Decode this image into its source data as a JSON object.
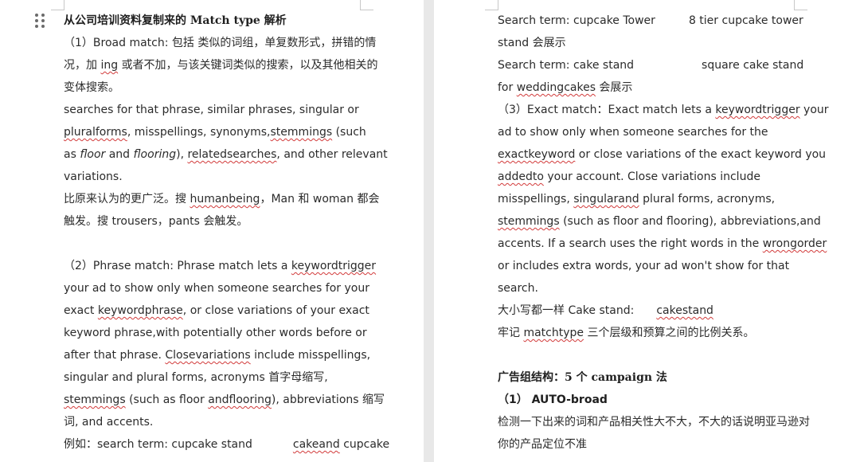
{
  "left": {
    "title": "从公司培训资料复制来的 Match type 解析",
    "broad_intro_1": "（1）Broad match: 包括 类似的词组，单复数形式，拼错的情",
    "broad_intro_2a": "况，加",
    "broad_intro_2b": "ing",
    "broad_intro_2c": "或者不加，与该关键词类似的搜索，以及其他相关的",
    "broad_intro_3": "变体搜索。",
    "broad_en_1": "searches for that phrase, similar phrases, singular or",
    "broad_en_2a": "pluralforms",
    "broad_en_2b": ", misspellings, synonyms,",
    "broad_en_2c": "stemmings",
    "broad_en_2d": " (such",
    "broad_en_3a": "as ",
    "broad_en_3b": "floor",
    "broad_en_3c": " and ",
    "broad_en_3d": "flooring",
    "broad_en_3e": "), ",
    "broad_en_3f": "relatedsearches",
    "broad_en_3g": ", and other relevant",
    "broad_en_4": "variations.",
    "broad_cn_1a": "比原来认为的更广泛。搜 ",
    "broad_cn_1b": "humanbeing",
    "broad_cn_1c": "，Man 和 woman 都会",
    "broad_cn_2": "触发。搜 trousers，pants 会触发。",
    "phrase_1a": "（2）Phrase match:    Phrase match lets a ",
    "phrase_1b": "keywordtrigger",
    "phrase_2": "your ad to show only when someone searches for your",
    "phrase_3a": "exact ",
    "phrase_3b": "keywordphrase",
    "phrase_3c": ", or close variations of your exact",
    "phrase_4": "keyword phrase,with potentially other words before or",
    "phrase_5a": "after that phrase. ",
    "phrase_5b": "Closevariations",
    "phrase_5c": " include misspellings,",
    "phrase_6": "singular and plural forms, acronyms  首字母缩写,",
    "phrase_7a": "stemmings",
    "phrase_7b": " (such as floor ",
    "phrase_7c": "andflooring",
    "phrase_7d": "), abbreviations  缩写",
    "phrase_8": "词, and accents.",
    "phrase_9a": "例如：search term: cupcake stand",
    "phrase_9b": "cakeand",
    "phrase_9c": " cupcake"
  },
  "right": {
    "r1a": "Search term:    cupcake Tower",
    "r1b": "8 tier cupcake tower",
    "r2": "stand  会展示",
    "r3a": "Search term:    cake stand",
    "r3b": "square cake stand",
    "r4a": "for ",
    "r4b": "weddingcakes",
    "r4c": "  会展示",
    "exact_1a": "（3）Exact match：Exact match lets a ",
    "exact_1b": "keywordtrigger",
    "exact_1c": " your",
    "exact_2": "ad to show only when someone searches for the",
    "exact_3a": "exactkeyword",
    "exact_3b": " or close variations of the exact keyword you",
    "exact_4a": "addedto",
    "exact_4b": " your account. Close variations include",
    "exact_5a": "misspellings, ",
    "exact_5b": "singularand",
    "exact_5c": " plural forms, acronyms,",
    "exact_6a": "stemmings",
    "exact_6b": " (such as floor and flooring), abbreviations,and",
    "exact_7a": "accents. If a search uses the right words in the ",
    "exact_7b": "wrongorder",
    "exact_8": "or includes extra words, your ad won't show for that",
    "exact_9": "search.",
    "case_1a": "大小写都一样  Cake stand:",
    "case_1b": "cakestand",
    "remember_a": "牢记 ",
    "remember_b": "matchtype",
    "remember_c": " 三个层级和预算之间的比例关系。",
    "structure_heading": "广告组结构：5 个 campaign 法",
    "auto_heading": "（1） AUTO-broad",
    "auto_1": "检测一下出来的词和产品相关性大不大，不大的话说明亚马逊对",
    "auto_2": "你的产品定位不准"
  }
}
